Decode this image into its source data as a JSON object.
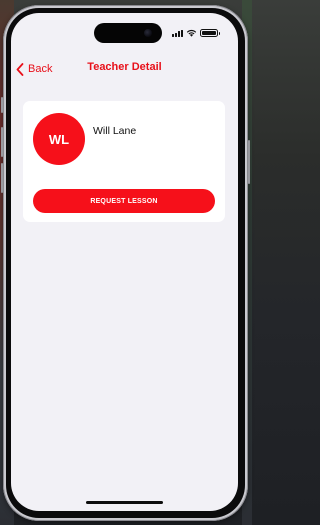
{
  "status_bar": {
    "icons": [
      "cellular-signal-icon",
      "wifi-icon",
      "battery-icon"
    ]
  },
  "nav": {
    "back_label": "Back",
    "title": "Teacher Detail",
    "accent_color": "#e8101a"
  },
  "teacher": {
    "initials": "WL",
    "name": "Will Lane",
    "avatar_color": "#f6101a"
  },
  "actions": {
    "request_label": "REQUEST LESSON",
    "button_color": "#f6101a"
  }
}
